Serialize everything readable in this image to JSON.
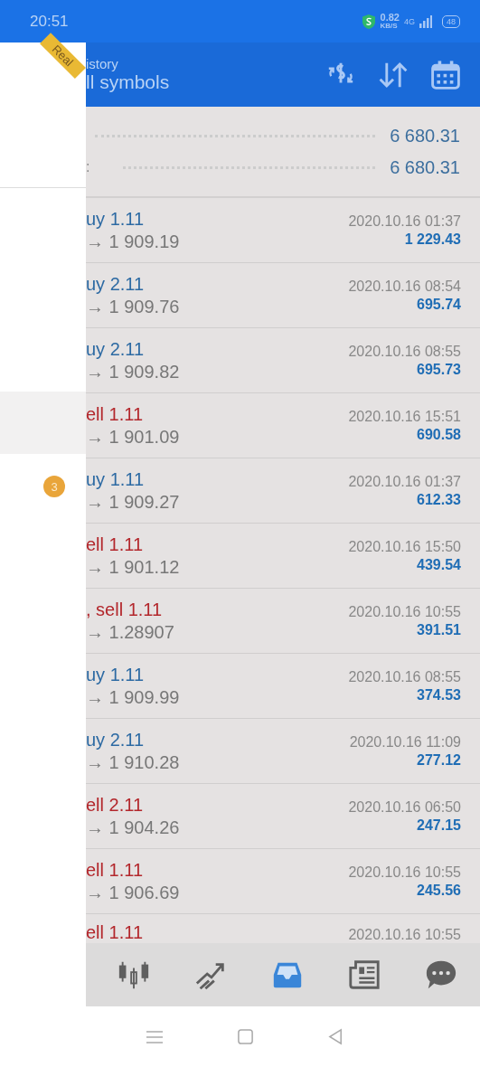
{
  "status_bar": {
    "time": "20:51",
    "speed": "0.82",
    "speed_unit": "KB/S",
    "network": "4G",
    "battery": "48"
  },
  "drawer": {
    "badge": "Real",
    "counter": "3"
  },
  "header": {
    "title": "istory",
    "subtitle": "ll symbols"
  },
  "summary": [
    {
      "value": "6 680.31"
    },
    {
      "label": ":",
      "value": "6 680.31"
    }
  ],
  "trades": [
    {
      "kind": "buy",
      "title": "uy 1.11",
      "prices": "→ 1 909.19",
      "time": "2020.10.16 01:37",
      "profit": "1 229.43"
    },
    {
      "kind": "buy",
      "title": "uy 2.11",
      "prices": "→ 1 909.76",
      "time": "2020.10.16 08:54",
      "profit": "695.74"
    },
    {
      "kind": "buy",
      "title": "uy 2.11",
      "prices": "→ 1 909.82",
      "time": "2020.10.16 08:55",
      "profit": "695.73"
    },
    {
      "kind": "sell",
      "title": "ell 1.11",
      "prices": "→ 1 901.09",
      "time": "2020.10.16 15:51",
      "profit": "690.58"
    },
    {
      "kind": "buy",
      "title": "uy 1.11",
      "prices": "→ 1 909.27",
      "time": "2020.10.16 01:37",
      "profit": "612.33"
    },
    {
      "kind": "sell",
      "title": "ell 1.11",
      "prices": "→ 1 901.12",
      "time": "2020.10.16 15:50",
      "profit": "439.54"
    },
    {
      "kind": "sell",
      "title": ", sell 1.11",
      "prices": "→ 1.28907",
      "time": "2020.10.16 10:55",
      "profit": "391.51"
    },
    {
      "kind": "buy",
      "title": "uy 1.11",
      "prices": "→ 1 909.99",
      "time": "2020.10.16 08:55",
      "profit": "374.53"
    },
    {
      "kind": "buy",
      "title": "uy 2.11",
      "prices": "→ 1 910.28",
      "time": "2020.10.16 11:09",
      "profit": "277.12"
    },
    {
      "kind": "sell",
      "title": "ell 2.11",
      "prices": "→ 1 904.26",
      "time": "2020.10.16 06:50",
      "profit": "247.15"
    },
    {
      "kind": "sell",
      "title": "ell 1.11",
      "prices": "→ 1 906.69",
      "time": "2020.10.16 10:55",
      "profit": "245.56"
    },
    {
      "kind": "sell",
      "title": "ell 1.11",
      "time": "2020.10.16 10:55"
    }
  ],
  "toolbar": [
    {
      "kind": "quotes",
      "selected": false
    },
    {
      "kind": "trade",
      "selected": false
    },
    {
      "kind": "history",
      "selected": true
    },
    {
      "kind": "news",
      "selected": false
    },
    {
      "kind": "chat",
      "selected": false
    }
  ]
}
